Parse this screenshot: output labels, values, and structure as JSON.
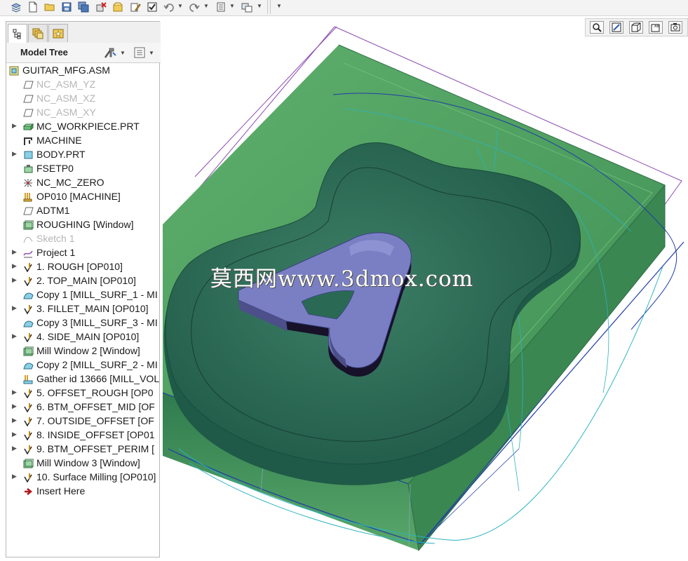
{
  "toolbar": {
    "icons": [
      "layers-icon",
      "new-file-icon",
      "open-folder-icon",
      "save-icon",
      "save-copy-icon",
      "erase-icon",
      "close-window-icon",
      "edit-icon",
      "regenerate-icon",
      "undo-icon",
      "redo-icon",
      "settings-icon",
      "window-icon",
      "more-icon"
    ]
  },
  "left_panel": {
    "tabs": [
      "model-tree-tab",
      "layer-tree-tab",
      "favorites-tab"
    ],
    "header_title": "Model Tree"
  },
  "tree": [
    {
      "label": "GUITAR_MFG.ASM",
      "icon": "assembly-icon",
      "expander": false,
      "dim": false,
      "root": true
    },
    {
      "label": "NC_ASM_YZ",
      "icon": "datum-plane-icon",
      "expander": false,
      "dim": true
    },
    {
      "label": "NC_ASM_XZ",
      "icon": "datum-plane-icon",
      "expander": false,
      "dim": true
    },
    {
      "label": "NC_ASM_XY",
      "icon": "datum-plane-icon",
      "expander": false,
      "dim": true
    },
    {
      "label": "MC_WORKPIECE.PRT",
      "icon": "workpiece-icon",
      "expander": true,
      "dim": false
    },
    {
      "label": "MACHINE",
      "icon": "machine-icon",
      "expander": false,
      "dim": false
    },
    {
      "label": "BODY.PRT",
      "icon": "part-icon",
      "expander": true,
      "dim": false
    },
    {
      "label": "FSETP0",
      "icon": "fixture-icon",
      "expander": false,
      "dim": false
    },
    {
      "label": "NC_MC_ZERO",
      "icon": "coordinate-system-icon",
      "expander": false,
      "dim": false
    },
    {
      "label": "OP010 [MACHINE]",
      "icon": "operation-icon",
      "expander": false,
      "dim": false
    },
    {
      "label": "ADTM1",
      "icon": "datum-plane-icon",
      "expander": false,
      "dim": false
    },
    {
      "label": "ROUGHING [Window]",
      "icon": "mill-window-icon",
      "expander": false,
      "dim": false
    },
    {
      "label": "Sketch 1",
      "icon": "sketch-icon",
      "expander": false,
      "dim": true
    },
    {
      "label": "Project 1",
      "icon": "project-icon",
      "expander": true,
      "dim": false
    },
    {
      "label": "1. ROUGH [OP010]",
      "icon": "toolpath-icon",
      "expander": true,
      "dim": false
    },
    {
      "label": "2. TOP_MAIN [OP010]",
      "icon": "toolpath-icon",
      "expander": true,
      "dim": false
    },
    {
      "label": "Copy 1 [MILL_SURF_1 - MI",
      "icon": "mill-surface-icon",
      "expander": false,
      "dim": false
    },
    {
      "label": "3. FILLET_MAIN [OP010]",
      "icon": "toolpath-icon",
      "expander": true,
      "dim": false
    },
    {
      "label": "Copy 3 [MILL_SURF_3 - MI",
      "icon": "mill-surface-icon",
      "expander": false,
      "dim": false
    },
    {
      "label": "4. SIDE_MAIN [OP010]",
      "icon": "toolpath-icon",
      "expander": true,
      "dim": false
    },
    {
      "label": "Mill Window 2 [Window]",
      "icon": "mill-window-icon",
      "expander": false,
      "dim": false
    },
    {
      "label": "Copy 2 [MILL_SURF_2 - MI",
      "icon": "mill-surface-icon",
      "expander": false,
      "dim": false
    },
    {
      "label": "Gather id 13666 [MILL_VOL",
      "icon": "gather-icon",
      "expander": false,
      "dim": false
    },
    {
      "label": "5. OFFSET_ROUGH [OP0",
      "icon": "toolpath-icon",
      "expander": true,
      "dim": false
    },
    {
      "label": "6. BTM_OFFSET_MID [OF",
      "icon": "toolpath-icon",
      "expander": true,
      "dim": false
    },
    {
      "label": "7. OUTSIDE_OFFSET [OF",
      "icon": "toolpath-icon",
      "expander": true,
      "dim": false
    },
    {
      "label": "8. INSIDE_OFFSET [OP01",
      "icon": "toolpath-icon",
      "expander": true,
      "dim": false
    },
    {
      "label": "9. BTM_OFFSET_PERIM [",
      "icon": "toolpath-icon",
      "expander": true,
      "dim": false
    },
    {
      "label": "Mill Window 3 [Window]",
      "icon": "mill-window-icon",
      "expander": false,
      "dim": false
    },
    {
      "label": "10. Surface Milling [OP010]",
      "icon": "toolpath-icon",
      "expander": true,
      "dim": false
    },
    {
      "label": "Insert Here",
      "icon": "insert-here-icon",
      "expander": false,
      "dim": false
    }
  ],
  "view_toolbar": {
    "icons": [
      "refit-zoom-icon",
      "repaint-icon",
      "display-style-icon",
      "annotation-display-icon",
      "saved-views-icon"
    ]
  },
  "viewport": {
    "watermark": "莫西网www.3dmox.com"
  },
  "colors": {
    "workpiece_green": "#4f9a60",
    "part_dark_green": "#2d6b55",
    "letter_purple": "#7a7fc4",
    "toolpath_cyan": "#2ab3c0",
    "toolpath_blue": "#1f3da8",
    "outline_purple": "#8a3aa8"
  }
}
